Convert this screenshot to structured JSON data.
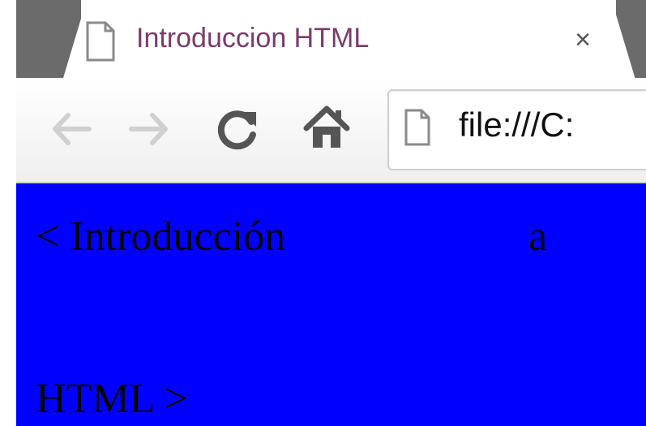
{
  "tab": {
    "title": "Introduccion HTML",
    "close_glyph": "×",
    "icon": "page-icon"
  },
  "toolbar": {
    "back_icon": "arrow-left-icon",
    "forward_icon": "arrow-right-icon",
    "reload_icon": "reload-icon",
    "home_icon": "home-icon",
    "address_value": "file:///C:"
  },
  "page": {
    "line1_text": "< Introducción",
    "line1_suffix": "a",
    "line2_text": "HTML >"
  },
  "colors": {
    "page_background": "#0000ff",
    "tab_title": "#7b3b6a",
    "tab_strip": "#6b6b6b"
  }
}
